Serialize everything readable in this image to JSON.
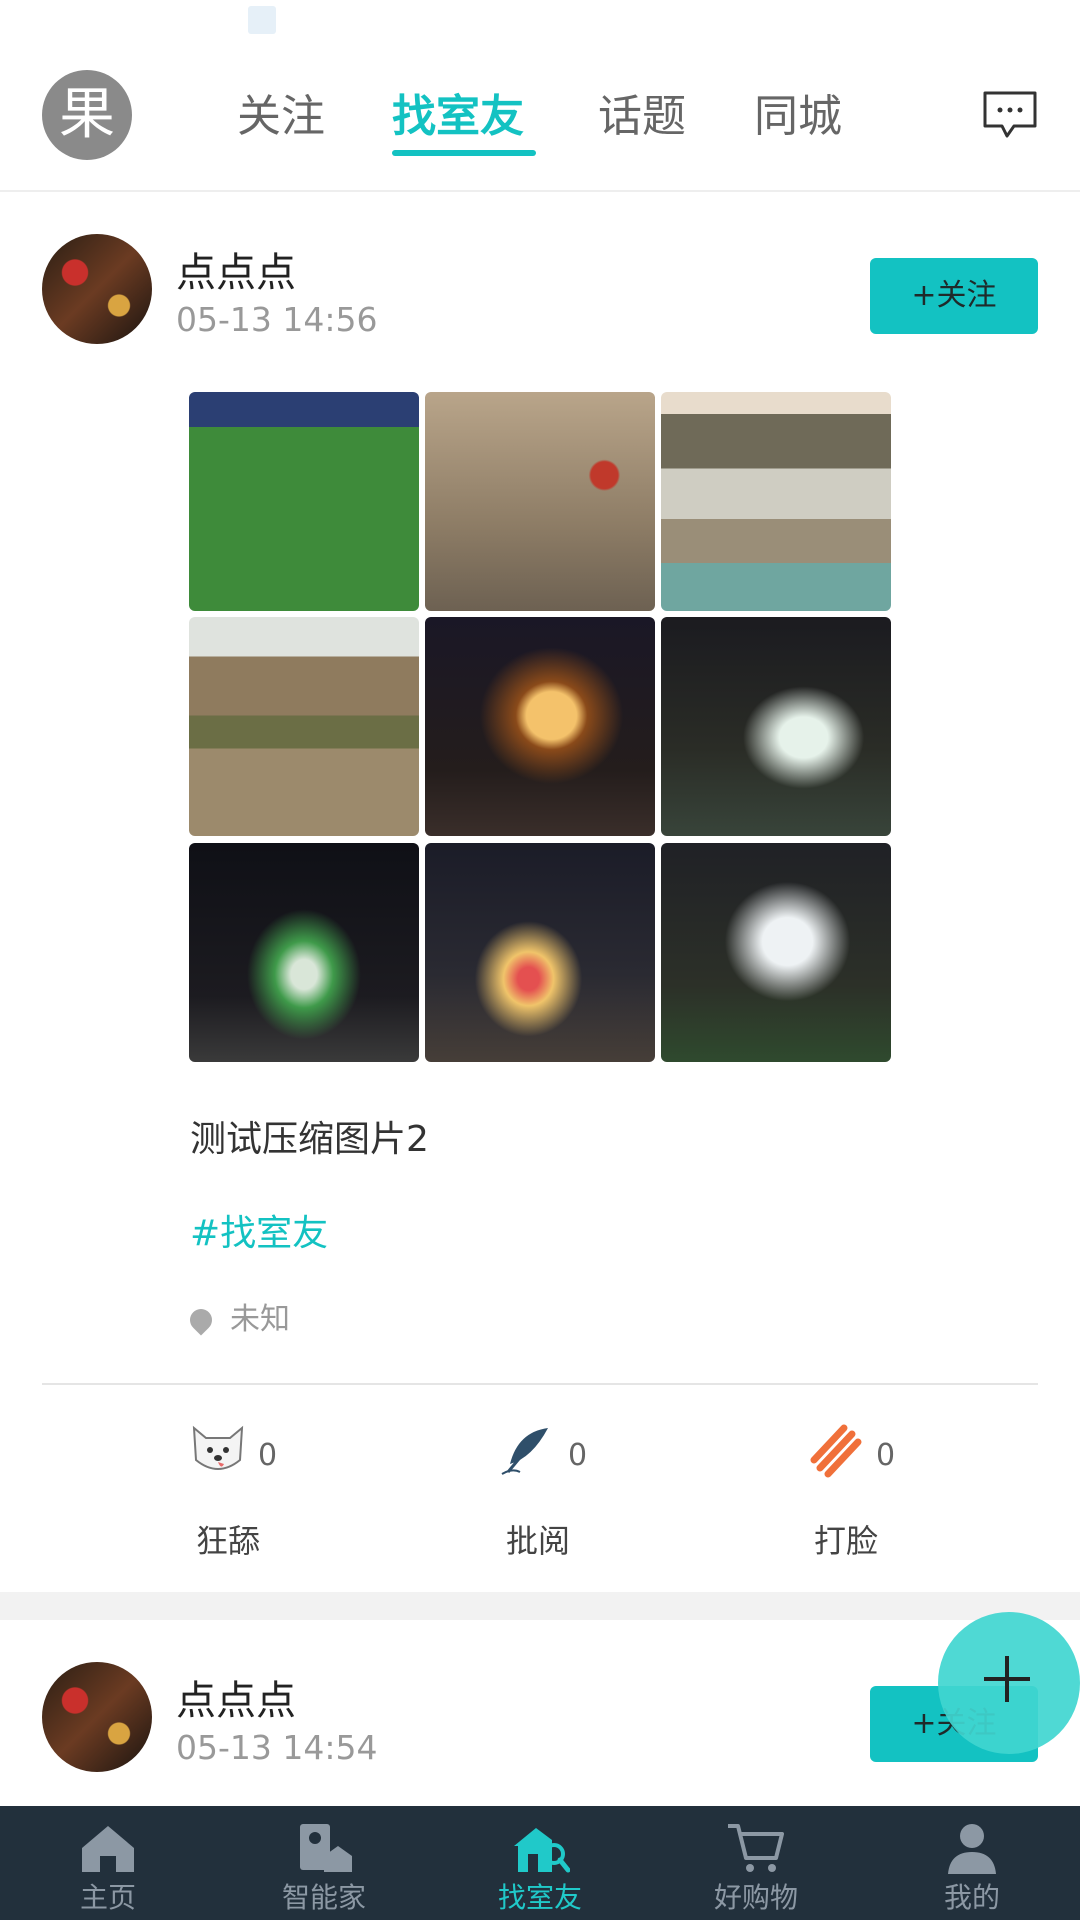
{
  "header": {
    "logo_char": "果",
    "tabs": [
      {
        "label": "关注",
        "active": false
      },
      {
        "label": "找室友",
        "active": true
      },
      {
        "label": "话题",
        "active": false
      },
      {
        "label": "同城",
        "active": false
      }
    ],
    "message_icon": "chat-bubble-icon"
  },
  "posts": [
    {
      "username": "点点点",
      "time": "05-13 14:56",
      "follow_label": "+关注",
      "text": "测试压缩图片2",
      "topic": "#找室友",
      "location": "未知",
      "photos": [
        "football-field",
        "rock-carving",
        "lake-hills",
        "mountain-cliffs",
        "lit-pavilion-night",
        "lit-trees-walkway",
        "light-sculpture-night",
        "flowerbed-lights-night",
        "lit-trees-park"
      ],
      "actions": [
        {
          "label": "狂舔",
          "count": "0",
          "icon": "dog-face-icon"
        },
        {
          "label": "批阅",
          "count": "0",
          "icon": "quill-pen-icon"
        },
        {
          "label": "打脸",
          "count": "0",
          "icon": "slap-hand-icon"
        }
      ]
    },
    {
      "username": "点点点",
      "time": "05-13 14:54",
      "follow_label": "+关注"
    }
  ],
  "fab_icon": "plus-icon",
  "bottom_nav": [
    {
      "label": "主页",
      "icon": "home-icon",
      "active": false
    },
    {
      "label": "智能家",
      "icon": "smart-home-icon",
      "active": false
    },
    {
      "label": "找室友",
      "icon": "house-search-icon",
      "active": true
    },
    {
      "label": "好购物",
      "icon": "shopping-cart-icon",
      "active": false
    },
    {
      "label": "我的",
      "icon": "person-icon",
      "active": false
    }
  ],
  "colors": {
    "accent": "#13c2c2",
    "nav_bg": "#22303c"
  }
}
